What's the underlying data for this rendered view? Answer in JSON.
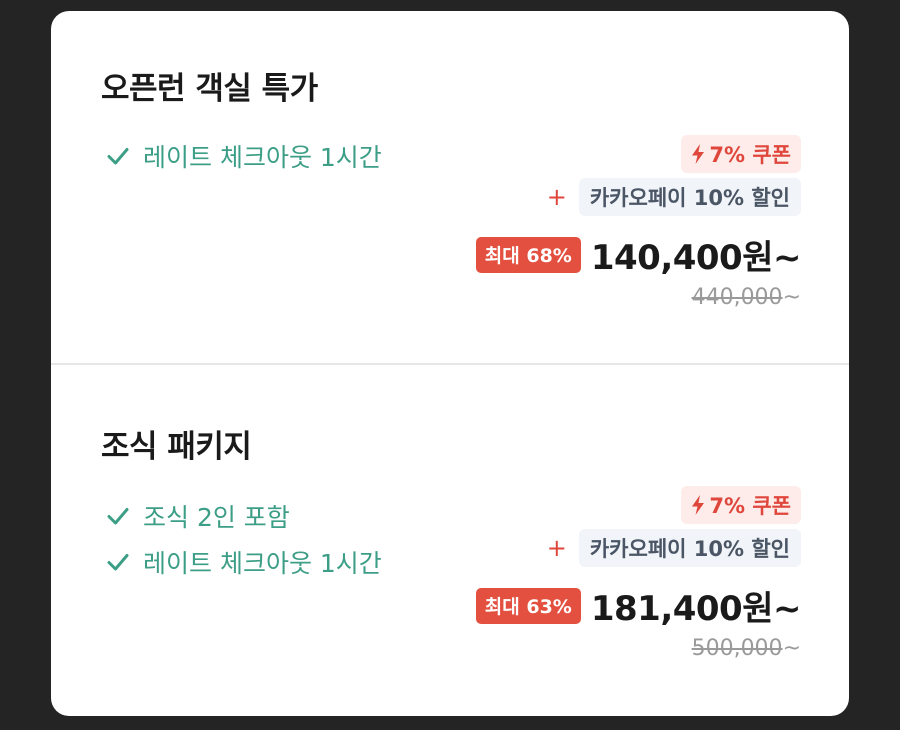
{
  "offers": [
    {
      "title": "오픈런 객실 특가",
      "features": [
        "레이트 체크아웃 1시간"
      ],
      "coupon_label": "7% 쿠폰",
      "plus_symbol": "+",
      "kakao_label": "카카오페이 10% 할인",
      "discount_label": "최대 68%",
      "price": "140,400원~",
      "original_price": "440,000",
      "original_price_suffix": "~"
    },
    {
      "title": "조식 패키지",
      "features": [
        "조식 2인 포함",
        "레이트 체크아웃 1시간"
      ],
      "coupon_label": "7% 쿠폰",
      "plus_symbol": "+",
      "kakao_label": "카카오페이 10% 할인",
      "discount_label": "최대 63%",
      "price": "181,400원~",
      "original_price": "500,000",
      "original_price_suffix": "~"
    }
  ],
  "icons": {
    "feature": "check-icon",
    "coupon": "lightning-bolt-icon",
    "plus": "plus-icon"
  },
  "colors": {
    "background": "#242424",
    "card": "#ffffff",
    "feature_green": "#3c9e86",
    "coupon_red": "#e0473c",
    "coupon_bg": "#fdecea",
    "kakao_bg": "#f1f4f8",
    "kakao_text": "#4a5565",
    "discount_bg": "#e4503f",
    "price_text": "#1a1a1a",
    "original_price_text": "#9a9a9a"
  }
}
